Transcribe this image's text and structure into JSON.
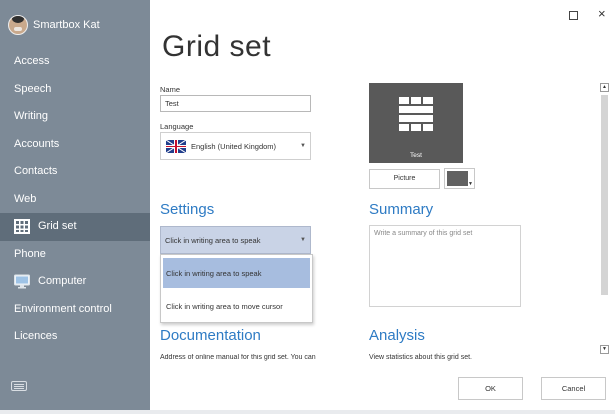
{
  "user": {
    "name": "Smartbox Kat"
  },
  "nav": {
    "items": [
      {
        "label": "Access"
      },
      {
        "label": "Speech"
      },
      {
        "label": "Writing"
      },
      {
        "label": "Accounts"
      },
      {
        "label": "Contacts"
      },
      {
        "label": "Web"
      },
      {
        "label": "Grid set",
        "active": true,
        "icon": "grid-set-icon"
      },
      {
        "label": "Phone"
      },
      {
        "label": "Computer",
        "icon": "monitor-icon"
      },
      {
        "label": "Environment control"
      },
      {
        "label": "Licences"
      }
    ]
  },
  "window_controls": {
    "close": "×"
  },
  "main": {
    "title": "Grid set",
    "name_label": "Name",
    "name_value": "Test",
    "language_label": "Language",
    "language_value": "English (United Kingdom)",
    "settings_title": "Settings",
    "settings_selected": "Click in writing area to speak",
    "settings_options": [
      "Click in writing area to speak",
      "Click in writing area to move cursor"
    ],
    "documentation_title": "Documentation",
    "documentation_text": "Address of online manual for this grid set. You can"
  },
  "right": {
    "tile_label": "Test",
    "picture_button": "Picture",
    "tile_color": "#595959",
    "summary_title": "Summary",
    "summary_placeholder": "Write a summary of this grid set",
    "analysis_title": "Analysis",
    "analysis_text": "View statistics about this grid set."
  },
  "buttons": {
    "ok": "OK",
    "cancel": "Cancel"
  },
  "colors": {
    "sidebar": "#7d8a97",
    "sidebar_active": "#5f6d7a",
    "accent": "#2e7bc4",
    "dropdown_selected": "#a7bddf"
  }
}
